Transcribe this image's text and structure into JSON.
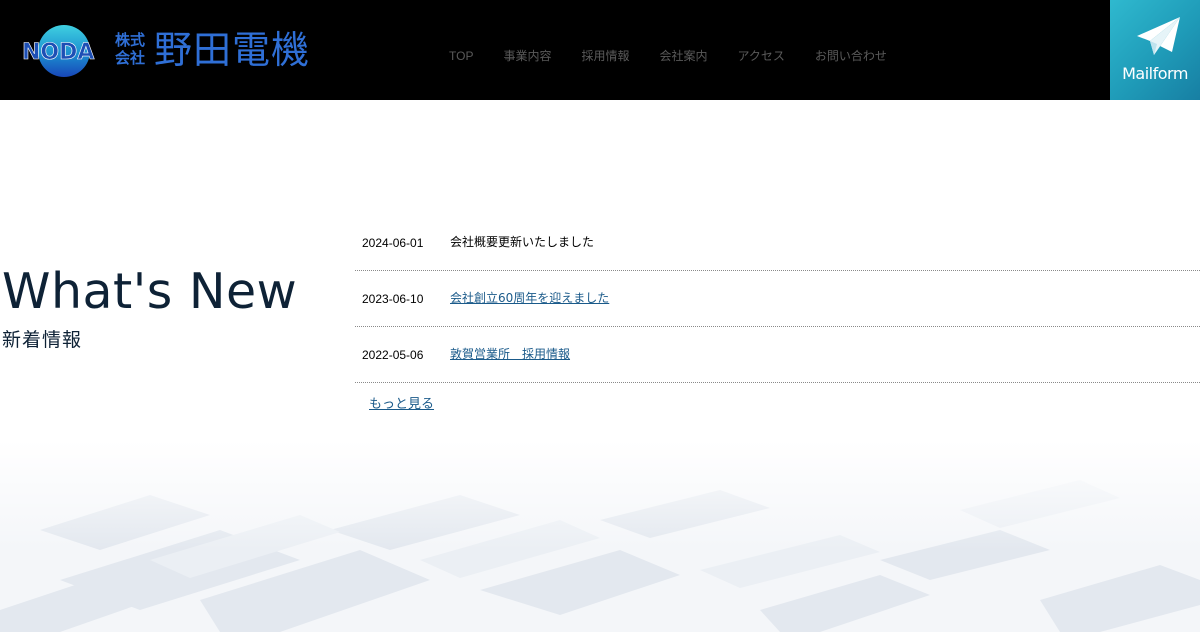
{
  "header": {
    "logo": {
      "mark_text": "NODA",
      "kabushiki": "株式\n会社",
      "company_name": "野田電機",
      "brand_color": "#2f6fd6"
    },
    "nav": [
      {
        "label": "TOP"
      },
      {
        "label": "事業内容"
      },
      {
        "label": "採用情報"
      },
      {
        "label": "会社案内"
      },
      {
        "label": "アクセス"
      },
      {
        "label": "お問い合わせ"
      }
    ],
    "mailform": {
      "label": "Mailform",
      "icon": "paper-plane-icon"
    }
  },
  "whats_new": {
    "title_en": "What's New",
    "title_ja": "新着情報",
    "items": [
      {
        "date": "2024-06-01",
        "text": "会社概要更新いたしました",
        "linked": false
      },
      {
        "date": "2023-06-10",
        "text": "会社創立60周年を迎えました",
        "linked": true
      },
      {
        "date": "2022-05-06",
        "text": "敦賀営業所　採用情報",
        "linked": true
      }
    ],
    "more_label": "もっと見る"
  },
  "colors": {
    "header_bg": "#000000",
    "nav_text": "#5a5a5a",
    "mailform_bg": "#1f9bb8",
    "title_text": "#0e2236",
    "link": "#1a5a8a"
  }
}
